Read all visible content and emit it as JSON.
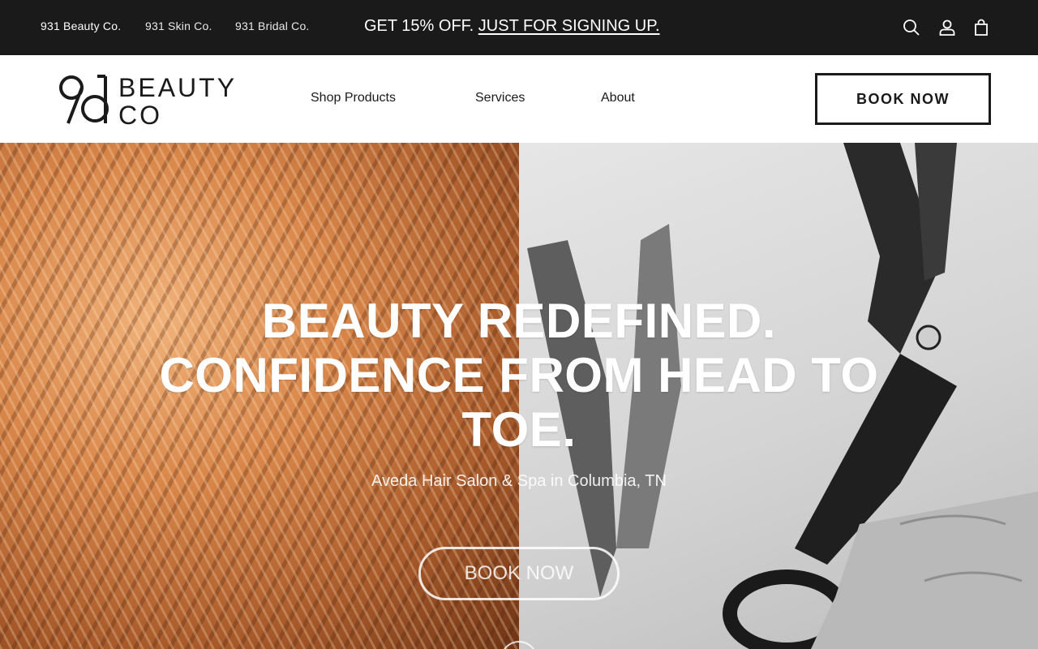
{
  "topbar": {
    "brand_links": [
      "931 Beauty Co.",
      "931 Skin Co.",
      "931 Bridal Co."
    ],
    "promo_text": "GET 15% OFF.",
    "promo_link": "JUST FOR SIGNING UP.",
    "icons": [
      "search-icon",
      "account-icon",
      "cart-icon"
    ]
  },
  "header": {
    "logo": {
      "mark": "931",
      "word_top": "BEAUTY",
      "word_bottom": "CO"
    },
    "nav": [
      "Shop Products",
      "Services",
      "About"
    ],
    "book_button": "BOOK NOW"
  },
  "hero": {
    "heading": "BEAUTY REDEFINED. CONFIDENCE FROM HEAD TO TOE.",
    "subheading": "Aveda Hair Salon & Spa in Columbia, TN",
    "button": "BOOK NOW"
  },
  "colors": {
    "topbar_bg": "#1b1a1a",
    "text_dark": "#1b1a1a",
    "white": "#ffffff"
  }
}
